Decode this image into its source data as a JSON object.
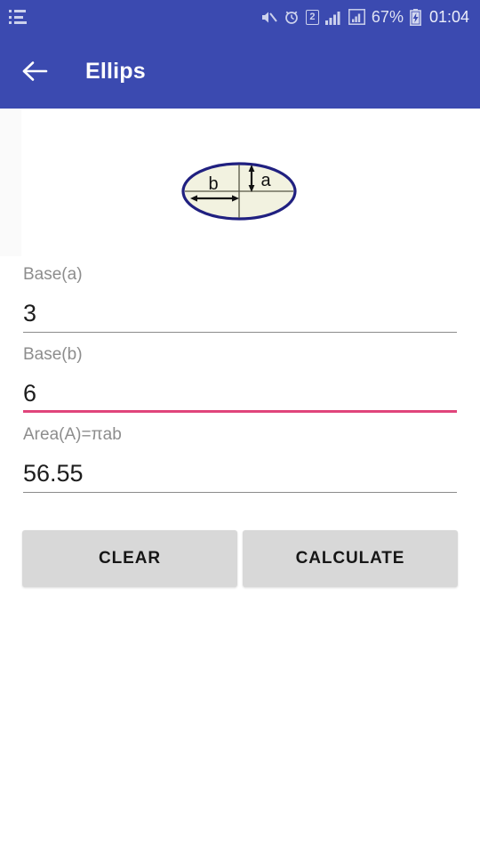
{
  "status_bar": {
    "menu_icon": "list-icon",
    "icons": [
      {
        "name": "mute-icon",
        "label": "Silent mode"
      },
      {
        "name": "alarm-icon",
        "label": "Alarm set"
      },
      {
        "name": "sim-badge-icon",
        "label": "2"
      },
      {
        "name": "signal-1-icon",
        "label": "Signal 1"
      },
      {
        "name": "signal-2-icon",
        "label": "Signal 2"
      }
    ],
    "battery_percent": "67%",
    "battery_icon": "battery-charging-icon",
    "time": "01:04"
  },
  "app_bar": {
    "back_icon": "back-arrow-icon",
    "title": "Ellips",
    "background_color": "#3b4ab0"
  },
  "diagram": {
    "name": "ellipse-diagram",
    "label_a": "a",
    "label_b": "b",
    "outline_color": "#202080",
    "fill_color": "#f2f2e0"
  },
  "form": {
    "fields": [
      {
        "name": "base-a",
        "label": "Base(a)",
        "value": "3",
        "placeholder": "",
        "focused": false,
        "underline_color": "#8b8b8b"
      },
      {
        "name": "base-b",
        "label": "Base(b)",
        "value": "6",
        "placeholder": "",
        "focused": true,
        "underline_color": "#e0457b"
      },
      {
        "name": "area",
        "label": "Area(A)=πab",
        "value": "56.55",
        "placeholder": "",
        "focused": false,
        "underline_color": "#8b8b8b"
      }
    ],
    "clear_label": "CLEAR",
    "calculate_label": "CALCULATE"
  }
}
